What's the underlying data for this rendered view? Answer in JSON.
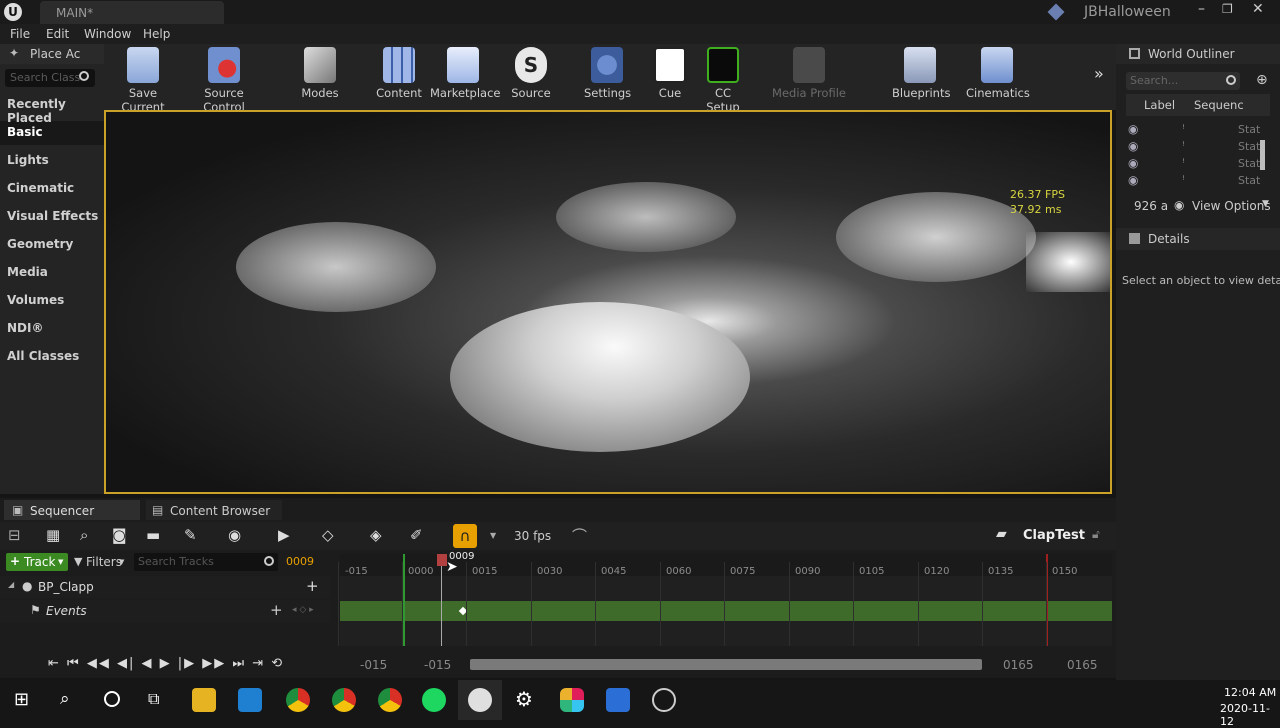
{
  "window": {
    "tab_title": "MAIN*",
    "project_name": "JBHalloween"
  },
  "menu": [
    "File",
    "Edit",
    "Window",
    "Help"
  ],
  "place_actors": {
    "tab_label": "Place Ac",
    "search_placeholder": "Search Class",
    "categories": [
      "Recently Placed",
      "Basic",
      "Lights",
      "Cinematic",
      "Visual Effects",
      "Geometry",
      "Media",
      "Volumes",
      "NDI®",
      "All Classes"
    ],
    "selected": "Basic"
  },
  "toolbar": {
    "buttons": [
      "Save Current",
      "Source Control",
      "Modes",
      "Content",
      "Marketplace",
      "Source",
      "Settings",
      "Cue",
      "CC Setup",
      "Media Profile",
      "Blueprints",
      "Cinematics"
    ]
  },
  "viewport": {
    "fps": "26.37 FPS",
    "ms": "37.92 ms"
  },
  "outliner": {
    "title": "World Outliner",
    "search_placeholder": "Search...",
    "col_label": "Label",
    "col_sequence": "Sequenc",
    "rows": [
      "Stat",
      "Stat",
      "Stat",
      "Stat"
    ],
    "count": "926 a",
    "view_options": "View Options"
  },
  "details": {
    "title": "Details",
    "empty_text": "Select an object to view details"
  },
  "tabs": {
    "sequencer": "Sequencer",
    "content_browser": "Content Browser"
  },
  "sequencer": {
    "fps_label": "30 fps",
    "sequence_name": "ClapTest",
    "track_button": "Track",
    "filters_button": "Filters",
    "search_placeholder": "Search Tracks",
    "current_frame": "0009",
    "playhead_label": "0009",
    "ticks": [
      "-015",
      "0000",
      "0015",
      "0030",
      "0045",
      "0060",
      "0075",
      "0090",
      "0105",
      "0120",
      "0135",
      "0150"
    ],
    "tracks": {
      "root": "BP_Clapp",
      "child": "Events"
    },
    "range_start_a": "-015",
    "range_start_b": "-015",
    "range_end_a": "0165",
    "range_end_b": "0165"
  },
  "taskbar": {
    "time": "12:04 AM",
    "date": "2020-11-12"
  },
  "colors": {
    "accent_orange": "#e8a000",
    "track_green": "#3f6b2a",
    "viewport_border": "#c9a227",
    "button_green": "#3b8b22"
  }
}
